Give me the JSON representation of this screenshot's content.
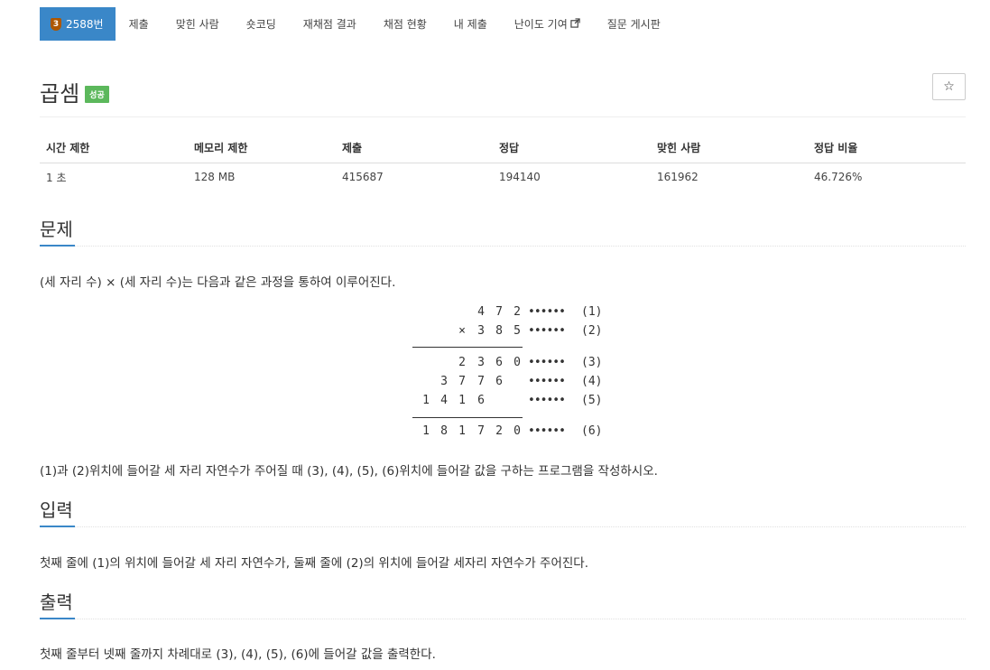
{
  "tabs": {
    "tier": "3",
    "problem_number": "2588번",
    "items": [
      "제출",
      "맞힌 사람",
      "숏코딩",
      "재채점 결과",
      "채점 현황",
      "내 제출",
      "난이도 기여",
      "질문 게시판"
    ]
  },
  "problem": {
    "title": "곱셈",
    "status_badge": "성공",
    "star_icon": "☆"
  },
  "info_table": {
    "headers": [
      "시간 제한",
      "메모리 제한",
      "제출",
      "정답",
      "맞힌 사람",
      "정답 비율"
    ],
    "values": [
      "1 초",
      "128 MB",
      "415687",
      "194140",
      "161962",
      "46.726%"
    ]
  },
  "sections": {
    "description": {
      "title": "문제",
      "intro": "(세 자리 수) × (세 자리 수)는 다음과 같은 과정을 통하여 이루어진다.",
      "outro": "(1)과 (2)위치에 들어갈 세 자리 자연수가 주어질 때 (3), (4), (5), (6)위치에 들어갈 값을 구하는 프로그램을 작성하시오."
    },
    "input": {
      "title": "입력",
      "text": "첫째 줄에 (1)의 위치에 들어갈 세 자리 자연수가, 둘째 줄에 (2)의 위치에 들어갈 세자리 자연수가 주어진다."
    },
    "output": {
      "title": "출력",
      "text": "첫째 줄부터 넷째 줄까지 차례대로 (3), (4), (5), (6)에 들어갈 값을 출력한다."
    }
  },
  "diagram": {
    "multiply_sign": "×",
    "dots": "••••••",
    "rows": [
      {
        "digits": [
          "4",
          "7",
          "2"
        ],
        "label": "(1)"
      },
      {
        "digits": [
          "3",
          "8",
          "5"
        ],
        "label": "(2)"
      },
      {
        "digits": [
          "2",
          "3",
          "6",
          "0"
        ],
        "label": "(3)"
      },
      {
        "digits": [
          "3",
          "7",
          "7",
          "6"
        ],
        "label": "(4)"
      },
      {
        "digits": [
          "1",
          "4",
          "1",
          "6"
        ],
        "label": "(5)"
      },
      {
        "digits": [
          "1",
          "8",
          "1",
          "7",
          "2",
          "0"
        ],
        "label": "(6)"
      }
    ]
  },
  "colors": {
    "accent": "#3a87c8",
    "success": "#5cb85c",
    "tier_bronze": "#ad5600"
  }
}
